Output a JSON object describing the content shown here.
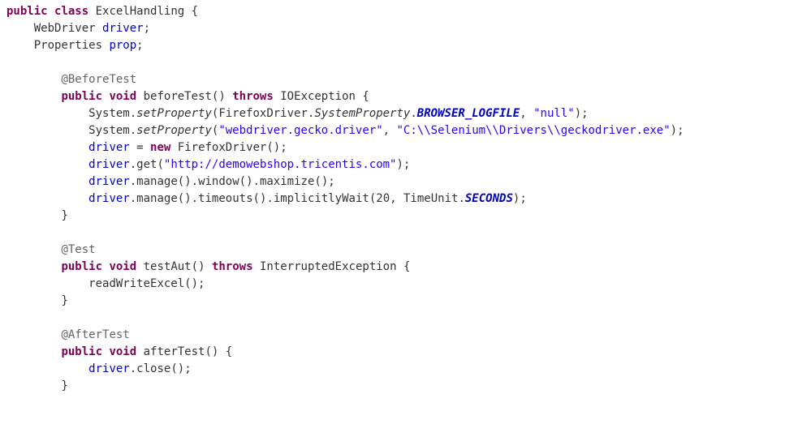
{
  "code": {
    "kw_public": "public",
    "kw_class": "class",
    "kw_void": "void",
    "kw_throws": "throws",
    "kw_new": "new",
    "cls_ExcelHandling": "ExcelHandling",
    "cls_WebDriver": "WebDriver",
    "cls_Properties": "Properties",
    "cls_IOException": "IOException",
    "cls_InterruptedException": "InterruptedException",
    "cls_FirefoxDriver": "FirefoxDriver",
    "cls_System": "System",
    "cls_TimeUnit": "TimeUnit",
    "ann_BeforeTest": "@BeforeTest",
    "ann_Test": "@Test",
    "ann_AfterTest": "@AfterTest",
    "fld_driver": "driver",
    "fld_prop": "prop",
    "m_beforeTest": "beforeTest",
    "m_testAut": "testAut",
    "m_afterTest": "afterTest",
    "m_setProperty": "setProperty",
    "m_SystemProperty": "SystemProperty",
    "c_BROWSER_LOGFILE": "BROWSER_LOGFILE",
    "c_SECONDS": "SECONDS",
    "m_get": "get",
    "m_manage": "manage",
    "m_window": "window",
    "m_maximize": "maximize",
    "m_timeouts": "timeouts",
    "m_implicitlyWait": "implicitlyWait",
    "m_readWriteExcel": "readWriteExcel",
    "m_close": "close",
    "str_null": "\"null\"",
    "str_geckoKey": "\"webdriver.gecko.driver\"",
    "str_geckoPath": "\"C:\\\\Selenium\\\\Drivers\\\\geckodriver.exe\"",
    "str_url": "\"http://demowebshop.tricentis.com\"",
    "num_20": "20",
    "p_lbrace": "{",
    "p_rbrace": "}",
    "p_lparen": "(",
    "p_rparen": ")",
    "p_semi": ";",
    "p_dot": ".",
    "p_comma": ",",
    "p_eq": "=",
    "sp": " "
  }
}
